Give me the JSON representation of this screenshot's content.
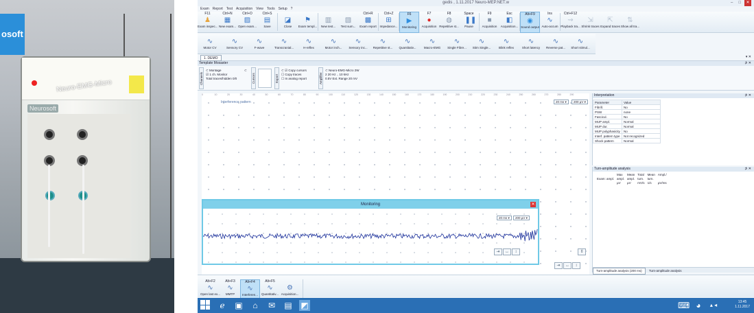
{
  "photo": {
    "bg_text": "osoft",
    "brand": "Neuro-EMG-Micro",
    "logo": "Neurosoft"
  },
  "window": {
    "title": "gedis , 1.11.2017  Neuro-MEP.NET.w",
    "controls": [
      "–",
      "□",
      "✕"
    ]
  },
  "menu": [
    "Exam",
    "Report",
    "Test",
    "Acquisition",
    "View",
    "Tools",
    "Setup",
    "?"
  ],
  "ribbon": [
    {
      "key": "F11",
      "label": "Exam inspec...",
      "icon": "person-icon",
      "color": "#e8a640"
    },
    {
      "key": "Ctrl+N",
      "label": "New exam...",
      "icon": "new-exam-icon",
      "color": "#3a78c8"
    },
    {
      "key": "Ctrl+O",
      "label": "Open exam...",
      "icon": "open-exam-icon",
      "color": "#3a78c8"
    },
    {
      "key": "Ctrl+S",
      "label": "Save",
      "icon": "save-icon",
      "color": "#3a78c8"
    },
    {
      "key": "",
      "label": "Close",
      "icon": "close-exam-icon",
      "color": "#3a78c8"
    },
    {
      "key": "",
      "label": "Exam templ...",
      "icon": "exam-template-icon",
      "color": "#3a78c8"
    },
    {
      "key": "",
      "label": "New test...",
      "icon": "new-test-icon",
      "color": "#8b9bb0"
    },
    {
      "key": "",
      "label": "Test sum...",
      "icon": "test-summary-icon",
      "color": "#8b9bb0"
    },
    {
      "key": "Ctrl+R",
      "label": "Exam report",
      "icon": "exam-report-icon",
      "color": "#3a78c8"
    },
    {
      "key": "Ctrl+Z",
      "label": "Impedance...",
      "icon": "impedance-icon",
      "color": "#3a78c8"
    },
    {
      "key": "F6",
      "label": "Monitoring",
      "icon": "play-icon",
      "color": "#2f8fe0",
      "active": true
    },
    {
      "key": "F7",
      "label": "Acquisition",
      "icon": "record-icon",
      "color": "#e02828"
    },
    {
      "key": "F8",
      "label": "Repetitive st...",
      "icon": "repetitive-icon",
      "color": "#8b9bb0"
    },
    {
      "key": "Space",
      "label": "Pause",
      "icon": "pause-icon",
      "color": "#3a78c8"
    },
    {
      "key": "F9",
      "label": "Acquisition",
      "icon": "acquisition-stop-icon",
      "color": "#8b9bb0"
    },
    {
      "key": "Esc",
      "label": "Acquisition...",
      "icon": "acquisition-cancel-icon",
      "color": "#3a78c8"
    },
    {
      "key": "Alt+F9",
      "label": "Sound output",
      "icon": "sound-icon",
      "color": "#2f8fe0",
      "active": true
    },
    {
      "key": "Ins",
      "label": "Auto-accum",
      "icon": "auto-accum-icon",
      "color": "#3a78c8"
    },
    {
      "key": "Ctrl+F12",
      "label": "Playback tra...",
      "icon": "playback-icon",
      "color": "#b8c4d2"
    },
    {
      "key": "",
      "label": "Shrink traces",
      "icon": "shrink-icon",
      "color": "#b8c4d2"
    },
    {
      "key": "",
      "label": "Expand traces",
      "icon": "expand-icon",
      "color": "#b8c4d2"
    },
    {
      "key": "",
      "label": "Show all tra...",
      "icon": "show-all-icon",
      "color": "#b8c4d2"
    }
  ],
  "ribbon2": [
    {
      "label": "Motor CV",
      "icon": "motor-cv-icon"
    },
    {
      "label": "Sensory CV",
      "icon": "sensory-cv-icon"
    },
    {
      "label": "F-wave",
      "icon": "f-wave-icon"
    },
    {
      "label": "Transcranial...",
      "icon": "transcranial-icon"
    },
    {
      "label": "H-reflex",
      "icon": "h-reflex-icon"
    },
    {
      "label": "Motor inch...",
      "icon": "motor-inching-icon"
    },
    {
      "label": "Sensory inc...",
      "icon": "sensory-inching-icon"
    },
    {
      "label": "Repetitive st...",
      "icon": "repetitive-stim-icon"
    },
    {
      "label": "Quantitativ...",
      "icon": "quantitative-icon"
    },
    {
      "label": "Macro-EMG",
      "icon": "macro-emg-icon"
    },
    {
      "label": "Single Fibre...",
      "icon": "single-fibre-icon"
    },
    {
      "label": "Stim Single...",
      "icon": "stim-single-icon"
    },
    {
      "label": "Blink reflex",
      "icon": "blink-reflex-icon"
    },
    {
      "label": "Short latency",
      "icon": "short-latency-icon"
    },
    {
      "label": "Reverse pat...",
      "icon": "reverse-pattern-icon"
    },
    {
      "label": "Short stimul...",
      "icon": "short-stimulus-icon"
    }
  ],
  "doc_tab": "1. DEMO",
  "template_header": "Template Mosaster",
  "template": {
    "channels_label": "Channels",
    "montage_label": "Montage",
    "montage_value": "1 ch. Monitor",
    "total_label": "Total traces/hidden 0/0",
    "cursors_label": "Cursors",
    "export_label": "Export",
    "copy_cursors": "Copy cursors",
    "copy_traces": "Copy traces",
    "in_analog": "In analog report",
    "amplifier_label": "Amplifier",
    "amp_model": "Neuro-EMG-Micro 2W",
    "amp_bw": "2 20 Hz  ..  10 kHz",
    "amp_range": "0.5V  Ext. Range  20 mV"
  },
  "ruler_ticks": [
    "0",
    "10",
    "20",
    "30",
    "40",
    "50",
    "60",
    "70",
    "80",
    "90",
    "100",
    "110",
    "120",
    "130",
    "140",
    "150",
    "160",
    "170",
    "180",
    "190",
    "200",
    "210",
    "220",
    "230",
    "240",
    "250",
    "260",
    "270",
    "280",
    "290"
  ],
  "pattern_label": "Interference pattern",
  "sweep_drop": "20 ms ▾",
  "sens_drop": "200 µV ▾",
  "interpretation": {
    "title": "Interpretation",
    "header": [
      "Parameter",
      "Value"
    ],
    "rows": [
      [
        "Fibrill.",
        "No"
      ],
      [
        "PSW",
        "none"
      ],
      [
        "Fascicul.",
        "No"
      ],
      [
        "MUP ampl.",
        "Normal"
      ],
      [
        "MUP dur.",
        "Normal"
      ],
      [
        "MUP polyphasicity",
        "No"
      ],
      [
        "Interf. pattern type",
        "Not recognized"
      ],
      [
        "Shock pattern",
        "Normal"
      ]
    ]
  },
  "turnamp": {
    "title": "Turn-amplitude analysis",
    "cols": [
      "Max",
      "Mean",
      "Total",
      "Mean",
      "Ampl./"
    ],
    "row1": [
      "Exam: ampl.",
      "ampl.",
      "ampl.",
      "turn.",
      "turn."
    ],
    "row2": [
      "µV",
      "µV",
      "mV/s",
      "1/s",
      "µV/ms"
    ],
    "tabs": [
      "Turn-amplitude analysis (200 ms)",
      "Turn-amplitude analysis"
    ]
  },
  "monitoring": {
    "title": "Monitoring",
    "sweep": "20 ms ▾",
    "sens": "200 µV ▾"
  },
  "bottom_buttons": [
    {
      "key": "Alt+F2",
      "label": "Open last ex...",
      "icon": "open-last-icon"
    },
    {
      "key": "Alt+F3",
      "label": "MMTP",
      "icon": "mmtp-icon"
    },
    {
      "key": "Alt+F4",
      "label": "Interferen...",
      "icon": "interference-icon",
      "active": true
    },
    {
      "key": "Alt+F5",
      "label": "Quantitativ...",
      "icon": "quantitative-mup-icon"
    },
    {
      "key": "",
      "label": "Acquisition...",
      "icon": "acquisition-settings-icon"
    }
  ],
  "taskbar": {
    "time": "13:45",
    "date": "1.11.2017"
  }
}
